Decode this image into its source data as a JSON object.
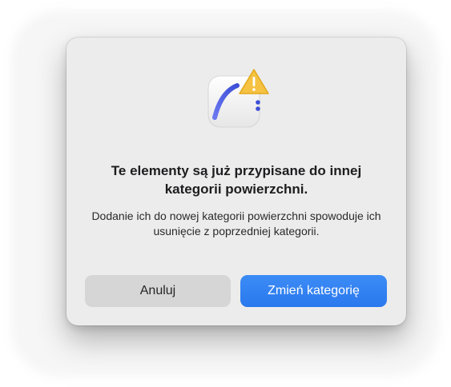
{
  "dialog": {
    "icon": "surface-pen-app-icon",
    "badge_icon": "warning-icon",
    "title": "Te elementy są już przypisane do innej kategorii powierzchni.",
    "message": "Dodanie ich do nowej kategorii powierzchni spowoduje ich usunięcie z poprzedniej kategorii.",
    "cancel_label": "Anuluj",
    "confirm_label": "Zmień kategorię"
  },
  "colors": {
    "dialog_background": "#ececec",
    "primary_button": "#2a78ee",
    "cancel_button": "#d6d6d6",
    "warning": "#f5c242"
  }
}
